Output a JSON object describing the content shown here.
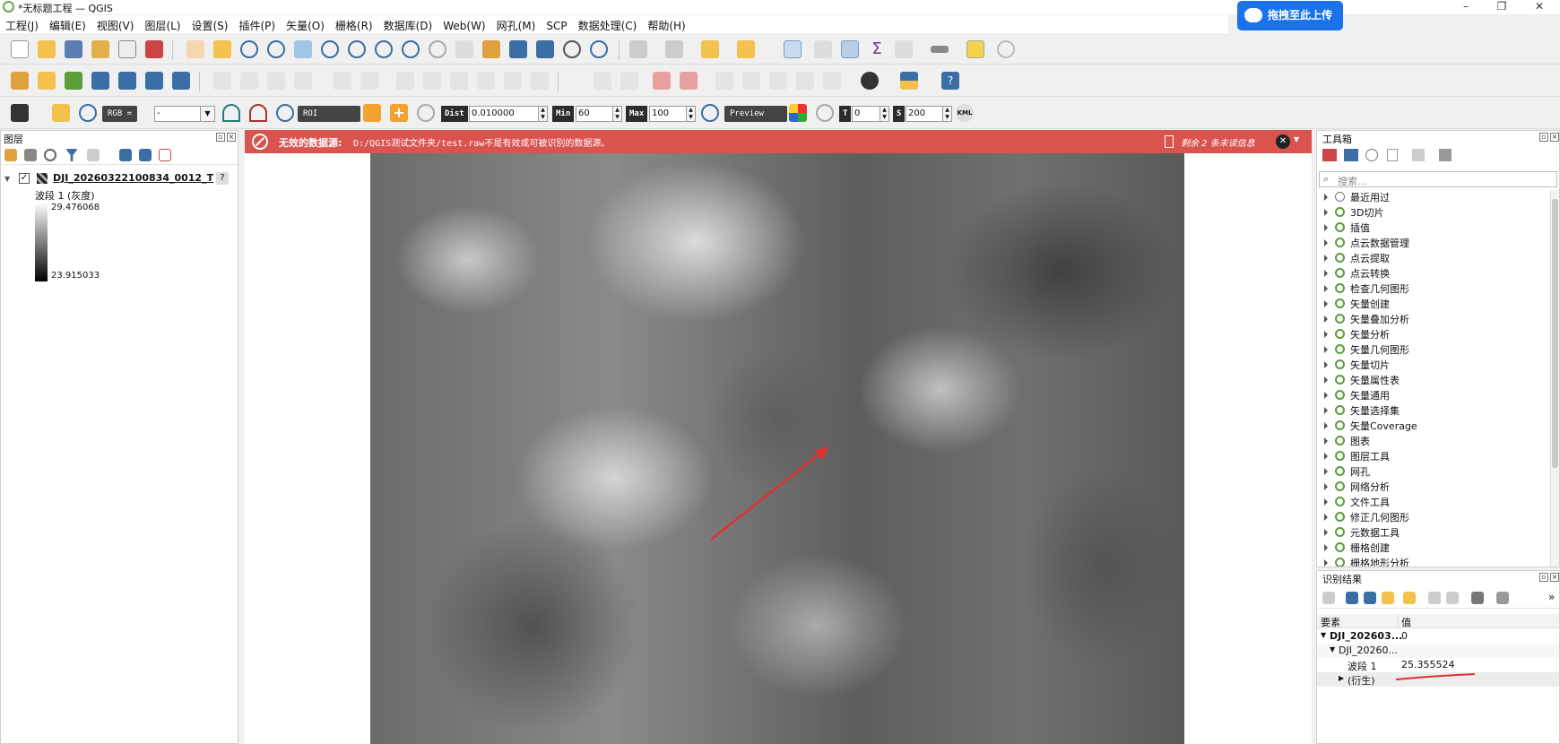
{
  "window": {
    "title": "*无标题工程 — QGIS",
    "minimize": "–",
    "maximize": "❐",
    "close": "✕"
  },
  "upload_button": {
    "label": "拖拽至此上传"
  },
  "menu": [
    "工程(J)",
    "编辑(E)",
    "视图(V)",
    "图层(L)",
    "设置(S)",
    "插件(P)",
    "矢量(O)",
    "栅格(R)",
    "数据库(D)",
    "Web(W)",
    "网孔(M)",
    "SCP",
    "数据处理(C)",
    "帮助(H)"
  ],
  "scp_toolbar": {
    "rgb_label": "RGB =",
    "rgb_value": "-",
    "roi_label": "ROI",
    "dist_label": "Dist",
    "dist_value": "0.010000",
    "min_label": "Min",
    "min_value": "60",
    "max_label": "Max",
    "max_value": "100",
    "preview_label": "Preview",
    "t_label": "T",
    "t_value": "0",
    "s_label": "S",
    "s_value": "200",
    "kml_label": "KML"
  },
  "layers_panel": {
    "title": "图层",
    "layer_name": "DJI_20260322100834_0012_T",
    "band_label": "波段 1 (灰度)",
    "max_value": "29.476068",
    "min_value": "23.915033",
    "help": "?"
  },
  "error_bar": {
    "title": "无效的数据源:",
    "message": "D:/QGIS测试文件夹/test.raw不是有效或可被识别的数据源。",
    "remaining": "剩余 2 条未读信息",
    "close": "✕"
  },
  "toolbox": {
    "title": "工具箱",
    "search_placeholder": "搜索...",
    "items": [
      "最近用过",
      "3D切片",
      "插值",
      "点云数据管理",
      "点云提取",
      "点云转换",
      "检查几何图形",
      "矢量创建",
      "矢量叠加分析",
      "矢量分析",
      "矢量几何图形",
      "矢量切片",
      "矢量属性表",
      "矢量通用",
      "矢量选择集",
      "矢量Coverage",
      "图表",
      "图层工具",
      "网孔",
      "网络分析",
      "文件工具",
      "修正几何图形",
      "元数据工具",
      "栅格创建",
      "栅格地形分析"
    ]
  },
  "identify": {
    "title": "识别结果",
    "col_feature": "要素",
    "col_value": "值",
    "rows": [
      {
        "name": "DJI_202603...",
        "value": "0"
      },
      {
        "name": "DJI_20260...",
        "value": ""
      },
      {
        "name": "波段 1",
        "value": "25.355524"
      },
      {
        "name": "(衍生)",
        "value": ""
      }
    ],
    "more": "»"
  },
  "colors": {
    "error": "#d9534f",
    "accent_green": "#5a9e3a",
    "annotation_red": "#e03030"
  }
}
